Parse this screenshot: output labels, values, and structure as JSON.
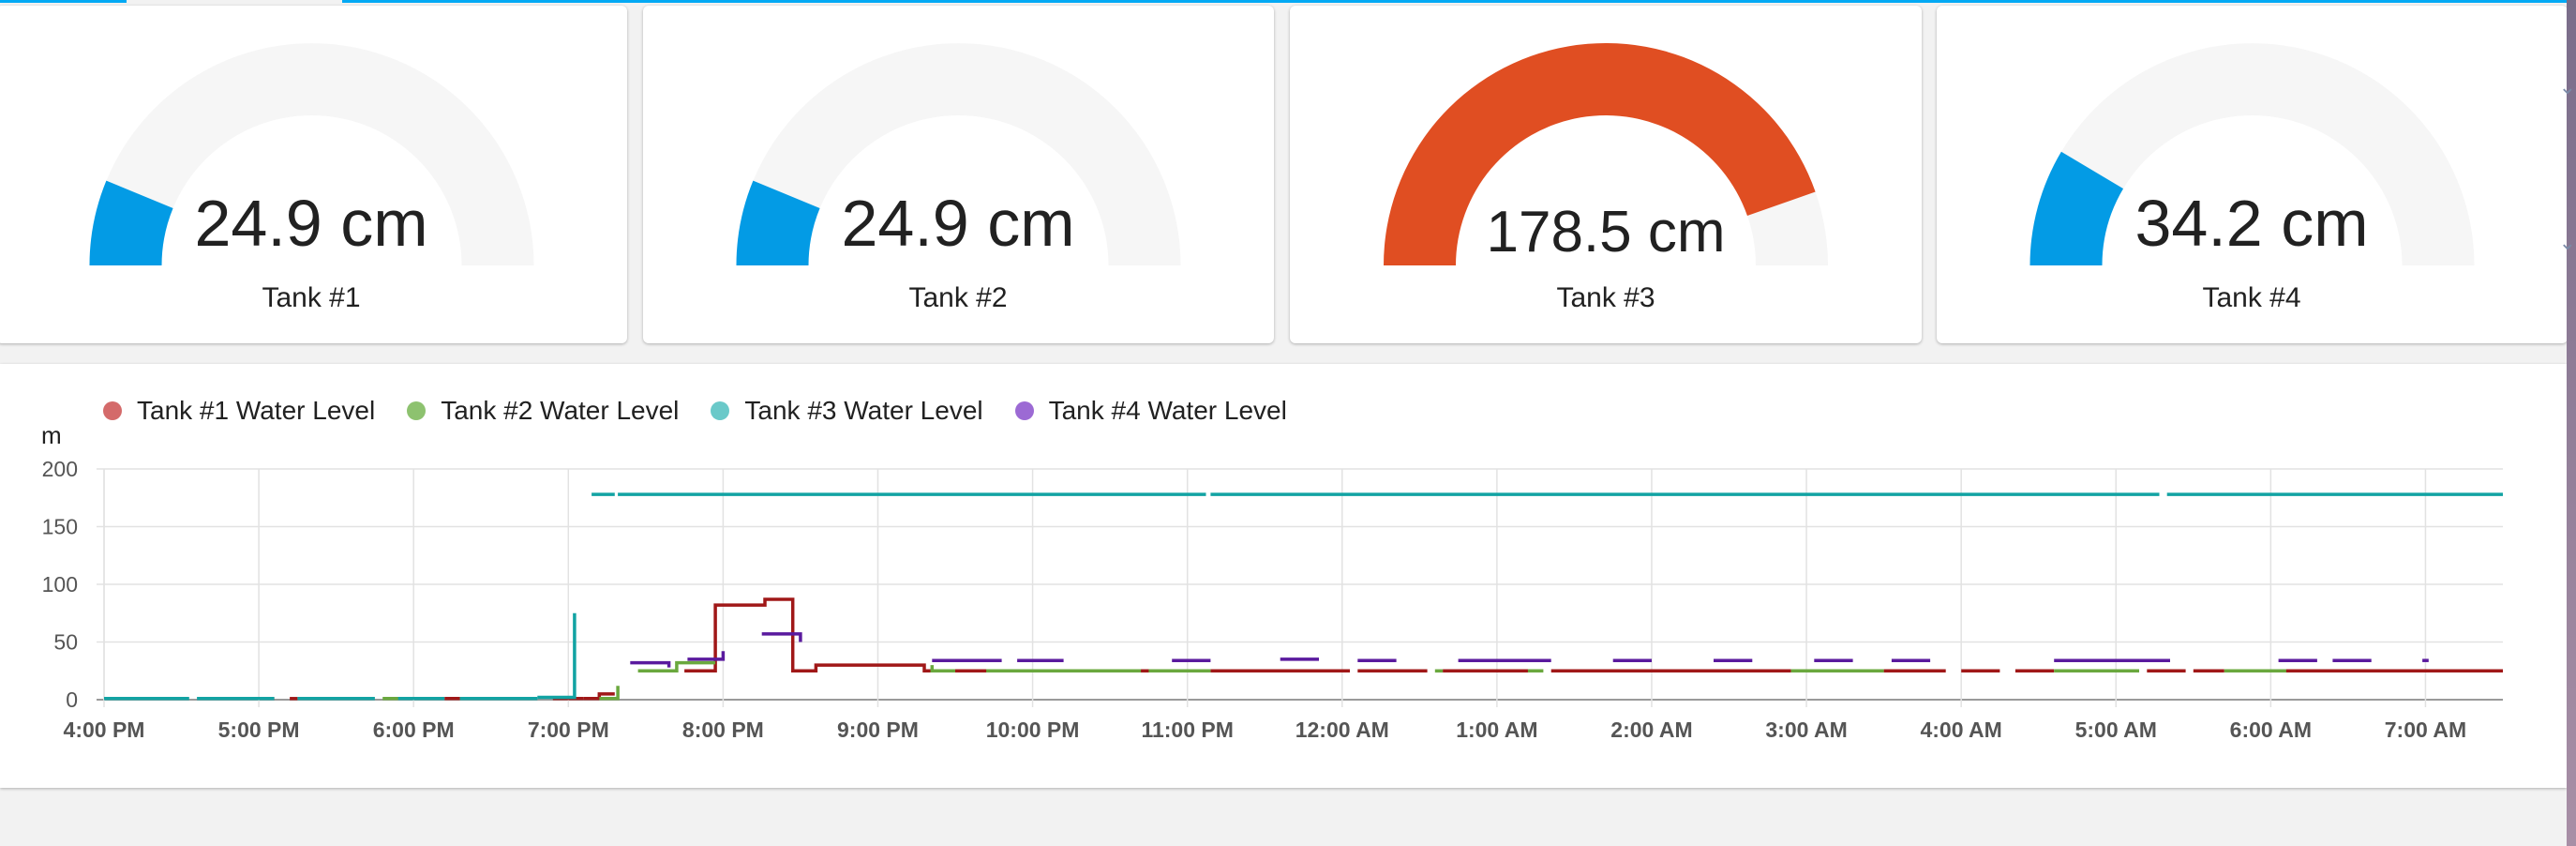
{
  "gauges": [
    {
      "value_text": "24.9 cm",
      "label": "Tank #1",
      "value": 24.9,
      "max": 200,
      "color": "#039be5"
    },
    {
      "value_text": "24.9 cm",
      "label": "Tank #2",
      "value": 24.9,
      "max": 200,
      "color": "#039be5"
    },
    {
      "value_text": "178.5 cm",
      "label": "Tank #3",
      "value": 178.5,
      "max": 200,
      "color": "#e04e22"
    },
    {
      "value_text": "34.2 cm",
      "label": "Tank #4",
      "value": 34.2,
      "max": 200,
      "color": "#039be5"
    }
  ],
  "gauge_track_color": "#f6f6f6",
  "history": {
    "unit": "m",
    "legend": [
      {
        "name": "Tank #1 Water Level",
        "color": "#d46a6a"
      },
      {
        "name": "Tank #2 Water Level",
        "color": "#8dc26f"
      },
      {
        "name": "Tank #3 Water Level",
        "color": "#6ac9c9"
      },
      {
        "name": "Tank #4 Water Level",
        "color": "#9c6ad4"
      }
    ]
  },
  "chart_data": {
    "type": "line",
    "step": true,
    "grid": true,
    "legend_position": "top-left",
    "ylabel": "m",
    "ylim": [
      0,
      200
    ],
    "yticks": [
      0,
      50,
      100,
      150,
      200
    ],
    "xlim": [
      16,
      31.5
    ],
    "xticks": [
      {
        "t": 16,
        "label": "4:00 PM"
      },
      {
        "t": 17,
        "label": "5:00 PM"
      },
      {
        "t": 18,
        "label": "6:00 PM"
      },
      {
        "t": 19,
        "label": "7:00 PM"
      },
      {
        "t": 20,
        "label": "8:00 PM"
      },
      {
        "t": 21,
        "label": "9:00 PM"
      },
      {
        "t": 22,
        "label": "10:00 PM"
      },
      {
        "t": 23,
        "label": "11:00 PM"
      },
      {
        "t": 24,
        "label": "12:00 AM"
      },
      {
        "t": 25,
        "label": "1:00 AM"
      },
      {
        "t": 26,
        "label": "2:00 AM"
      },
      {
        "t": 27,
        "label": "3:00 AM"
      },
      {
        "t": 28,
        "label": "4:00 AM"
      },
      {
        "t": 29,
        "label": "5:00 AM"
      },
      {
        "t": 30,
        "label": "6:00 AM"
      },
      {
        "t": 31,
        "label": "7:00 AM"
      }
    ],
    "series": [
      {
        "name": "Tank #1 Water Level",
        "color": "#a01818",
        "segments": [
          [
            [
              16.8,
              1
            ],
            [
              17.1,
              1
            ]
          ],
          [
            [
              17.2,
              1
            ],
            [
              17.25,
              1
            ]
          ],
          [
            [
              17.9,
              1
            ],
            [
              18.1,
              1
            ]
          ],
          [
            [
              18.2,
              1
            ],
            [
              18.3,
              1
            ]
          ],
          [
            [
              18.5,
              1
            ],
            [
              18.7,
              1
            ]
          ],
          [
            [
              18.9,
              1
            ],
            [
              19.1,
              1
            ]
          ],
          [
            [
              19.1,
              1
            ],
            [
              19.2,
              1
            ],
            [
              19.2,
              5
            ],
            [
              19.3,
              5
            ]
          ],
          [
            [
              19.75,
              25
            ],
            [
              19.95,
              25
            ],
            [
              19.95,
              82
            ],
            [
              20.27,
              82
            ],
            [
              20.27,
              87
            ],
            [
              20.45,
              87
            ],
            [
              20.45,
              25
            ],
            [
              20.6,
              25
            ],
            [
              20.6,
              30
            ],
            [
              21.3,
              30
            ],
            [
              21.3,
              25
            ],
            [
              22.3,
              25
            ]
          ],
          [
            [
              22.4,
              25
            ],
            [
              23.1,
              25
            ]
          ],
          [
            [
              23.15,
              25
            ],
            [
              24.05,
              25
            ]
          ],
          [
            [
              24.1,
              25
            ],
            [
              24.55,
              25
            ]
          ],
          [
            [
              24.65,
              25
            ],
            [
              25.25,
              25
            ]
          ],
          [
            [
              25.35,
              25
            ],
            [
              26.9,
              25
            ]
          ],
          [
            [
              27,
              25
            ],
            [
              27.4,
              25
            ]
          ],
          [
            [
              27.5,
              25
            ],
            [
              27.9,
              25
            ]
          ],
          [
            [
              28,
              25
            ],
            [
              28.25,
              25
            ]
          ],
          [
            [
              28.35,
              25
            ],
            [
              28.6,
              25
            ]
          ],
          [
            [
              28.7,
              25
            ],
            [
              29.15,
              25
            ]
          ],
          [
            [
              29.2,
              25
            ],
            [
              29.45,
              25
            ]
          ],
          [
            [
              29.5,
              25
            ],
            [
              29.7,
              25
            ]
          ],
          [
            [
              29.8,
              25
            ],
            [
              31.5,
              25
            ]
          ]
        ]
      },
      {
        "name": "Tank #2 Water Level",
        "color": "#6aa83e",
        "segments": [
          [
            [
              17.8,
              1
            ],
            [
              18.0,
              1
            ]
          ],
          [
            [
              18.3,
              1
            ],
            [
              18.55,
              1
            ]
          ],
          [
            [
              19.2,
              1
            ],
            [
              19.32,
              1
            ],
            [
              19.32,
              12
            ]
          ],
          [
            [
              19.45,
              25
            ],
            [
              19.7,
              25
            ],
            [
              19.7,
              32
            ],
            [
              19.95,
              32
            ]
          ],
          [
            [
              21.35,
              30
            ],
            [
              21.35,
              25
            ],
            [
              21.5,
              25
            ]
          ],
          [
            [
              21.7,
              25
            ],
            [
              22.7,
              25
            ]
          ],
          [
            [
              22.75,
              25
            ],
            [
              23.15,
              25
            ]
          ],
          [
            [
              24.6,
              25
            ],
            [
              24.65,
              25
            ]
          ],
          [
            [
              25.2,
              25
            ],
            [
              25.3,
              25
            ]
          ],
          [
            [
              26.9,
              25
            ],
            [
              27.5,
              25
            ]
          ],
          [
            [
              28.6,
              25
            ],
            [
              29.15,
              25
            ]
          ],
          [
            [
              29.7,
              25
            ],
            [
              30.1,
              25
            ]
          ]
        ]
      },
      {
        "name": "Tank #3 Water Level",
        "color": "#12a3a3",
        "segments": [
          [
            [
              16,
              1
            ],
            [
              16.55,
              1
            ]
          ],
          [
            [
              16.6,
              1
            ],
            [
              17.1,
              1
            ]
          ],
          [
            [
              17.25,
              1
            ],
            [
              17.75,
              1
            ]
          ],
          [
            [
              17.9,
              1
            ],
            [
              18.2,
              1
            ]
          ],
          [
            [
              18.3,
              1
            ],
            [
              18.8,
              1
            ]
          ],
          [
            [
              18.8,
              2
            ],
            [
              19.0,
              2
            ],
            [
              19.04,
              2
            ],
            [
              19.04,
              75
            ]
          ],
          [
            [
              19.15,
              178
            ],
            [
              19.3,
              178
            ]
          ],
          [
            [
              19.32,
              178
            ],
            [
              23.12,
              178
            ]
          ],
          [
            [
              23.15,
              178
            ],
            [
              29.28,
              178
            ]
          ],
          [
            [
              29.33,
              178
            ],
            [
              31.5,
              178
            ]
          ]
        ]
      },
      {
        "name": "Tank #4 Water Level",
        "color": "#5a1a9e",
        "segments": [
          [
            [
              19.4,
              32
            ],
            [
              19.65,
              32
            ],
            [
              19.65,
              28
            ]
          ],
          [
            [
              19.77,
              35
            ],
            [
              20.0,
              35
            ],
            [
              20.0,
              42
            ]
          ],
          [
            [
              20.25,
              57
            ],
            [
              20.5,
              57
            ],
            [
              20.5,
              50
            ]
          ],
          [
            [
              21.35,
              34
            ],
            [
              21.8,
              34
            ]
          ],
          [
            [
              21.9,
              34
            ],
            [
              22.2,
              34
            ]
          ],
          [
            [
              22.9,
              34
            ],
            [
              23.15,
              34
            ]
          ],
          [
            [
              23.6,
              35
            ],
            [
              23.85,
              35
            ]
          ],
          [
            [
              24.1,
              34
            ],
            [
              24.35,
              34
            ]
          ],
          [
            [
              24.75,
              34
            ],
            [
              25.35,
              34
            ]
          ],
          [
            [
              25.75,
              34
            ],
            [
              26.0,
              34
            ]
          ],
          [
            [
              26.4,
              34
            ],
            [
              26.65,
              34
            ]
          ],
          [
            [
              27.05,
              34
            ],
            [
              27.3,
              34
            ]
          ],
          [
            [
              27.55,
              34
            ],
            [
              27.8,
              34
            ]
          ],
          [
            [
              28.6,
              34
            ],
            [
              29.35,
              34
            ]
          ],
          [
            [
              30.05,
              34
            ],
            [
              30.3,
              34
            ]
          ],
          [
            [
              30.4,
              34
            ],
            [
              30.65,
              34
            ]
          ],
          [
            [
              30.98,
              34
            ],
            [
              31.02,
              34
            ]
          ]
        ]
      }
    ]
  }
}
